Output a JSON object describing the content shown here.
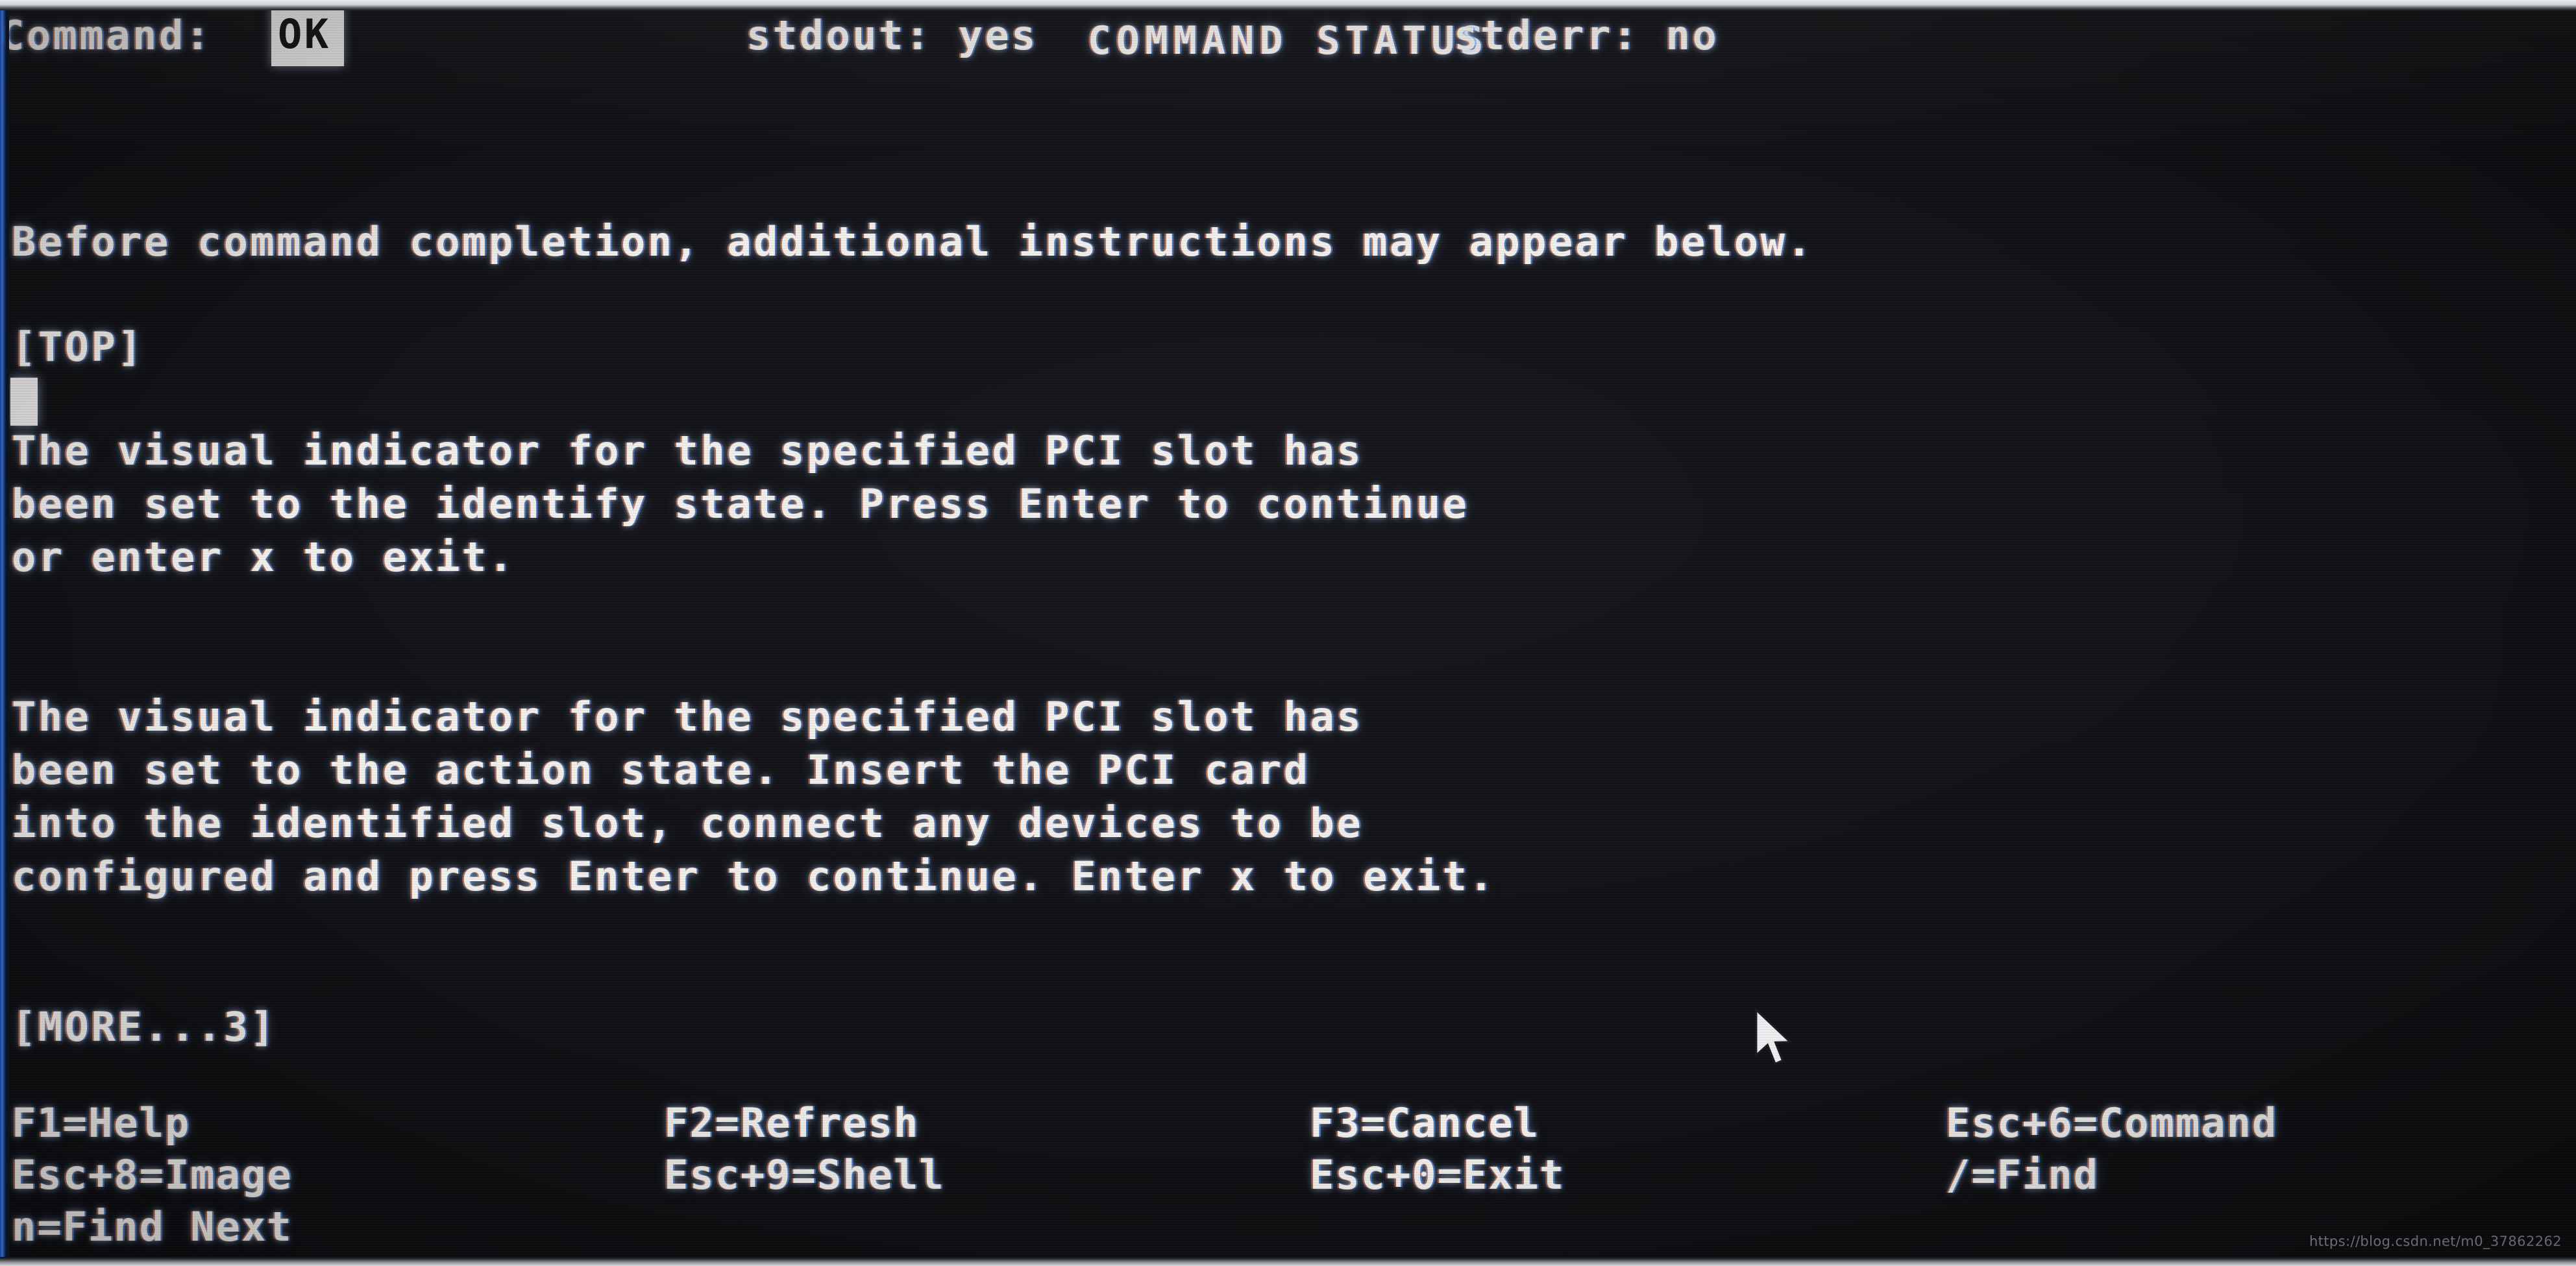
{
  "screen": {
    "title": "COMMAND STATUS",
    "background_color": "#0d0e11",
    "text_color": "#f4f3f0",
    "highlight_bg": "#f2f0ee",
    "highlight_fg": "#101014",
    "edge_glow_color": "#2f6fd0"
  },
  "status": {
    "command_label": "Command:",
    "command_value": "OK",
    "stdout_label": "stdout: yes",
    "stderr_label": "stderr: no"
  },
  "notice": "Before command completion, additional instructions may appear below.",
  "markers": {
    "top": "[TOP]",
    "more": "[MORE...3]"
  },
  "output": {
    "paragraph1": "The visual indicator for the specified PCI slot has\nbeen set to the identify state. Press Enter to continue\nor enter x to exit.",
    "paragraph2": "The visual indicator for the specified PCI slot has\nbeen set to the action state. Insert the PCI card\ninto the identified slot, connect any devices to be\nconfigured and press Enter to continue. Enter x to exit."
  },
  "function_keys": {
    "row1": [
      "F1=Help",
      "F2=Refresh",
      "F3=Cancel",
      "Esc+6=Command"
    ],
    "row2": [
      "Esc+8=Image",
      "Esc+9=Shell",
      "Esc+0=Exit",
      "/=Find"
    ],
    "row3": [
      "n=Find Next",
      "",
      "",
      ""
    ]
  },
  "watermark": "https://blog.csdn.net/m0_37862262",
  "pointer": {
    "icon": "mouse-pointer-icon"
  }
}
